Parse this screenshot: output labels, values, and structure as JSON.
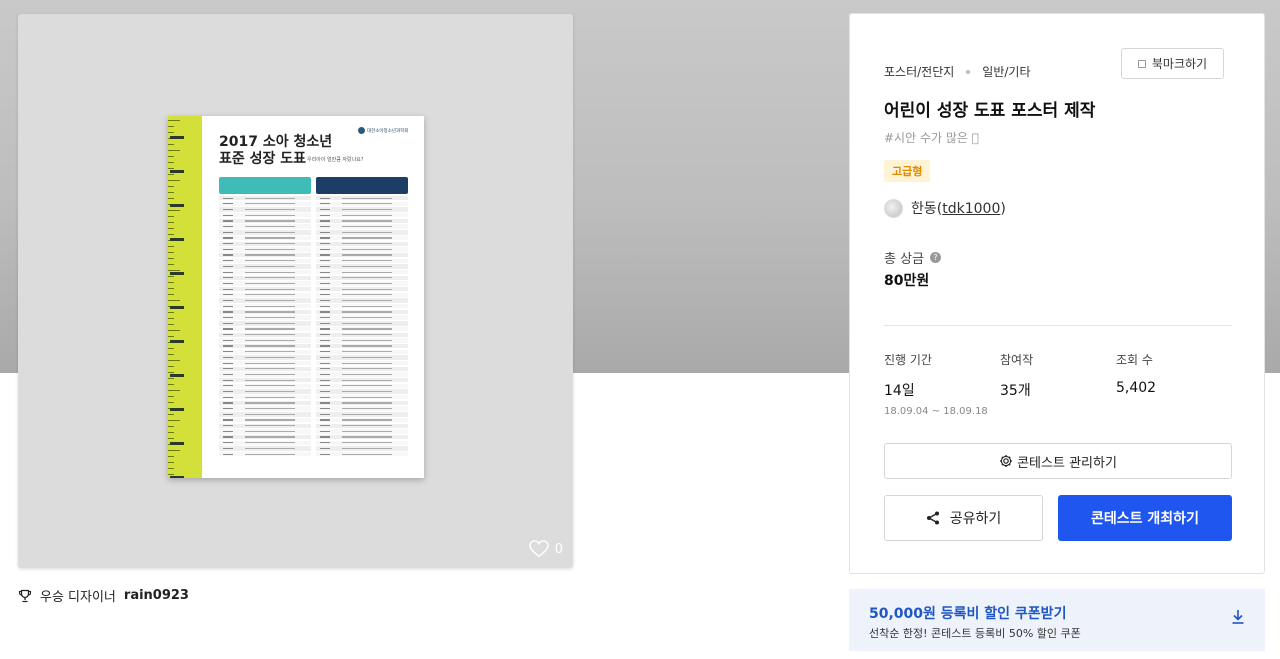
{
  "preview": {
    "poster": {
      "title_line1": "2017 소아 청소년",
      "title_line2": "표준 성장 도표",
      "subtitle": "우리아이 얼만큼 자랐나요?",
      "org": "대한소아청소년과학회"
    },
    "likes": "0"
  },
  "winner": {
    "label": "우승 디자이너",
    "name": "rain0923"
  },
  "info": {
    "category_primary": "포스터/전단지",
    "category_secondary": "일반/기타",
    "bookmark_label": "북마크하기",
    "title": "어린이 성장 도표 포스터 제작",
    "tags": "#시안 수가 많은 🏼",
    "badge": "고급형",
    "host_name": "한동",
    "host_id_open": "(",
    "host_id": "tdk1000",
    "host_id_close": ")",
    "prize_label": "총 상금",
    "prize_value": "80만원",
    "stats": {
      "duration_label": "진행 기간",
      "duration_value": "14일",
      "duration_range": "18.09.04 ~ 18.09.18",
      "participants_label": "참여작",
      "participants_value": "35개",
      "views_label": "조회 수",
      "views_value": "5,402"
    },
    "manage_label": "콘테스트 관리하기",
    "share_label": "공유하기",
    "host_contest_label": "콘테스트 개최하기"
  },
  "coupon": {
    "headline": "50,000원 등록비 할인 쿠폰받기",
    "detail": "선착순 한정! 콘테스트 등록비 50% 할인 쿠폰"
  },
  "colors": {
    "primary_button": "#1f56f0",
    "badge_bg": "#fff3d6",
    "badge_text": "#e08a00",
    "coupon_bg": "#eef3fb",
    "coupon_text": "#1f56c0"
  }
}
